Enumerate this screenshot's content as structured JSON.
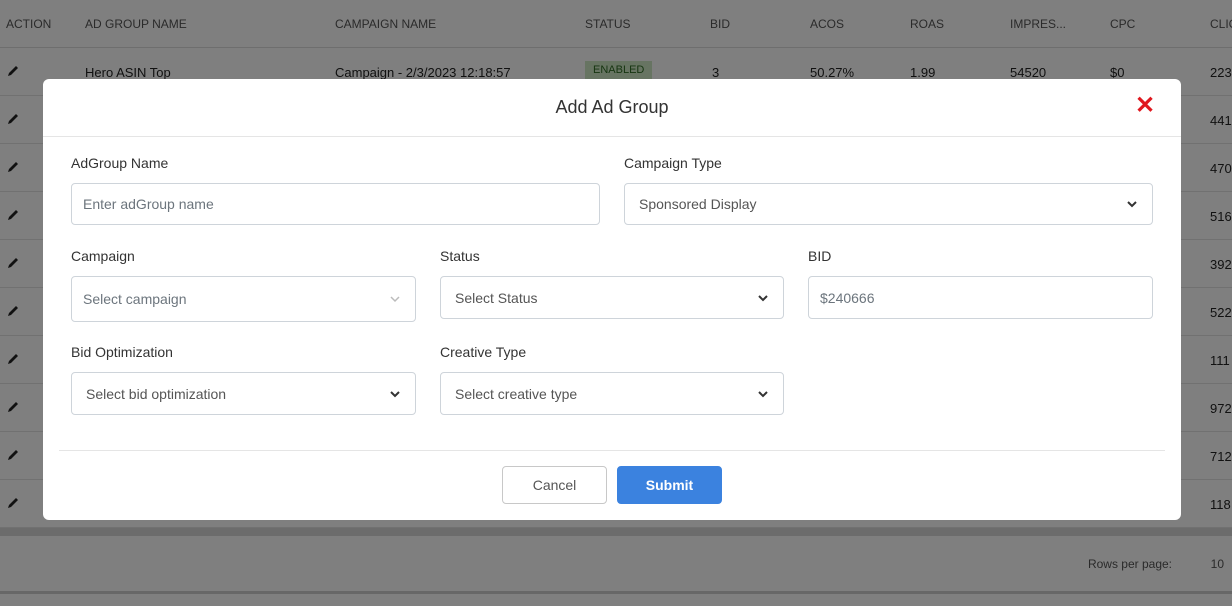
{
  "table": {
    "headers": [
      "ACTION",
      "AD GROUP NAME",
      "CAMPAIGN NAME",
      "STATUS",
      "BID",
      "ACOS",
      "ROAS",
      "IMPRES...",
      "CPC",
      "CLIC"
    ],
    "first_row": {
      "ad_group": "Hero ASIN Top",
      "campaign": "Campaign - 2/3/2023 12:18:57",
      "status": "ENABLED",
      "bid": "3",
      "acos": "50.27%",
      "roas": "1.99",
      "impressions": "54520",
      "cpc": "$0",
      "clicks": "223"
    },
    "clicks_column": [
      "223",
      "441",
      "470",
      "516",
      "392",
      "522",
      "111",
      "972",
      "712",
      "118"
    ],
    "rows_per_page_label": "Rows per page:",
    "rows_per_page_value": "10"
  },
  "modal": {
    "title": "Add Ad Group",
    "close_symbol": "✕",
    "fields": {
      "adgroup_name": {
        "label": "AdGroup Name",
        "placeholder": "Enter adGroup name"
      },
      "campaign_type": {
        "label": "Campaign Type",
        "value": "Sponsored Display"
      },
      "campaign": {
        "label": "Campaign",
        "placeholder": "Select campaign"
      },
      "status": {
        "label": "Status",
        "value": "Select Status"
      },
      "bid": {
        "label": "BID",
        "value": "$240666"
      },
      "bid_optimization": {
        "label": "Bid Optimization",
        "value": "Select bid optimization"
      },
      "creative_type": {
        "label": "Creative Type",
        "value": "Select creative type"
      }
    },
    "buttons": {
      "cancel": "Cancel",
      "submit": "Submit"
    }
  },
  "colors": {
    "close": "#e0181f",
    "submit": "#3b82df",
    "badge_bg": "#cfe9c4"
  }
}
